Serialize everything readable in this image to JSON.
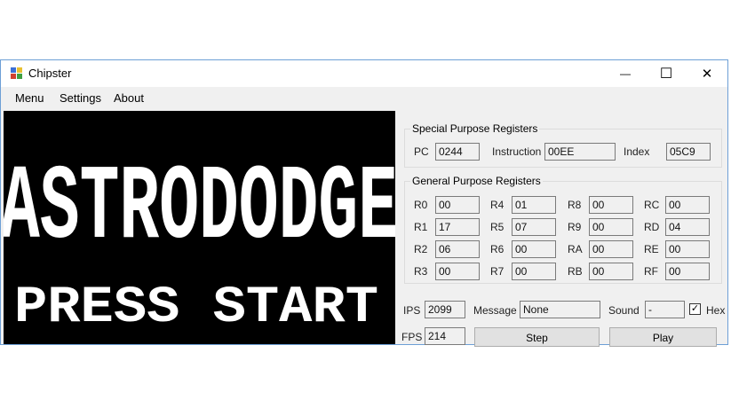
{
  "window": {
    "title": "Chipster",
    "minimize_glyph": "—",
    "maximize_glyph": "☐",
    "close_glyph": "✕",
    "icon": "app-icon"
  },
  "menu": [
    "Menu",
    "Settings",
    "About"
  ],
  "game_screen": {
    "title_text": "ASTRODODGE",
    "subtitle_text": "PRESS START"
  },
  "special_registers": {
    "title": "Special Purpose Registers",
    "pc_label": "PC",
    "pc_value": "0244",
    "instruction_label": "Instruction",
    "instruction_value": "00EE",
    "index_label": "Index",
    "index_value": "05C9"
  },
  "general_registers": {
    "title": "General Purpose Registers",
    "items": [
      {
        "label": "R0",
        "value": "00"
      },
      {
        "label": "R4",
        "value": "01"
      },
      {
        "label": "R8",
        "value": "00"
      },
      {
        "label": "RC",
        "value": "00"
      },
      {
        "label": "R1",
        "value": "17"
      },
      {
        "label": "R5",
        "value": "07"
      },
      {
        "label": "R9",
        "value": "00"
      },
      {
        "label": "RD",
        "value": "04"
      },
      {
        "label": "R2",
        "value": "06"
      },
      {
        "label": "R6",
        "value": "00"
      },
      {
        "label": "RA",
        "value": "00"
      },
      {
        "label": "RE",
        "value": "00"
      },
      {
        "label": "R3",
        "value": "00"
      },
      {
        "label": "R7",
        "value": "00"
      },
      {
        "label": "RB",
        "value": "00"
      },
      {
        "label": "RF",
        "value": "00"
      }
    ]
  },
  "status": {
    "ips_label": "IPS",
    "ips_value": "2099",
    "message_label": "Message",
    "message_value": "None",
    "sound_label": "Sound",
    "sound_value": "-",
    "hex_label": "Hex",
    "hex_checked": true,
    "check_glyph": "✓",
    "fps_label": "FPS",
    "fps_value": "214",
    "step_button": "Step",
    "play_button": "Play"
  }
}
